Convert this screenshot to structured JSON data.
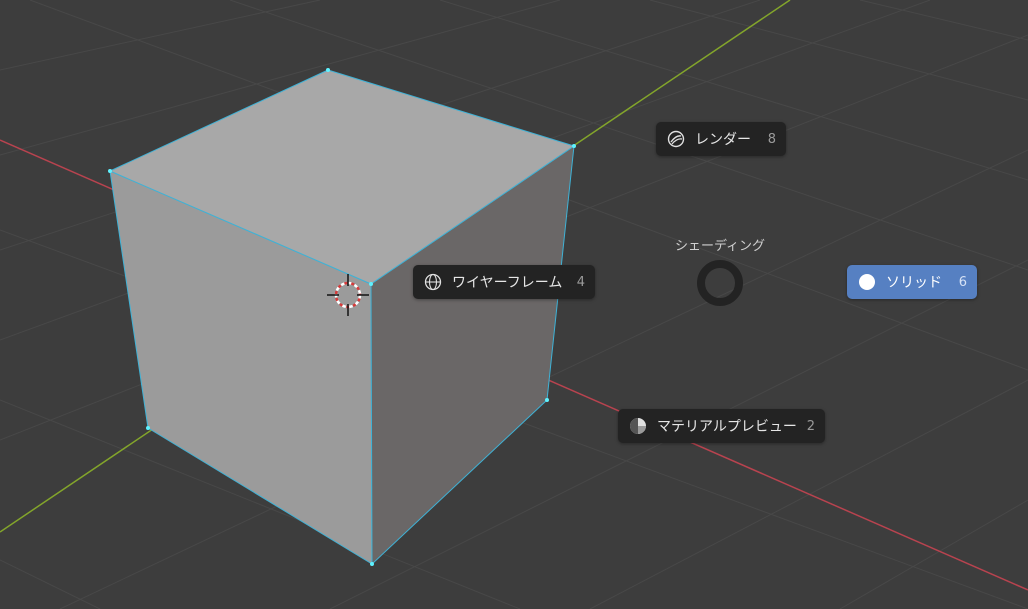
{
  "pie_menu": {
    "title": "シェーディング",
    "items": {
      "render": {
        "label": "レンダー",
        "key": "8",
        "icon": "render-shading-icon"
      },
      "wireframe": {
        "label": "ワイヤーフレーム",
        "key": "4",
        "icon": "wireframe-shading-icon"
      },
      "solid": {
        "label": "ソリッド",
        "key": "6",
        "icon": "solid-shading-icon",
        "selected": true
      },
      "material": {
        "label": "マテリアルプレビュー",
        "key": "2",
        "icon": "material-preview-shading-icon"
      }
    }
  },
  "colors": {
    "viewport_bg": "#3d3d3d",
    "grid_line": "#4a4a4a",
    "x_axis": "#b8434f",
    "y_axis": "#83a52b",
    "selection_outline": "#3fb2d6",
    "menu_item_bg": "#232323",
    "menu_active_bg": "#5680c2"
  }
}
